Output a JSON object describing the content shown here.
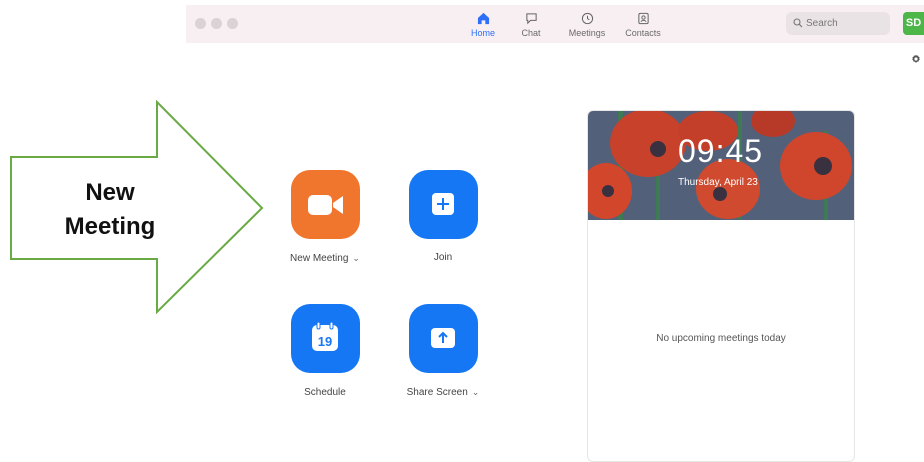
{
  "titlebar": {
    "tabs": [
      {
        "label": "Home",
        "icon": "home-icon",
        "active": true
      },
      {
        "label": "Chat",
        "icon": "chat-icon",
        "active": false
      },
      {
        "label": "Meetings",
        "icon": "clock-icon",
        "active": false
      },
      {
        "label": "Contacts",
        "icon": "contacts-icon",
        "active": false
      }
    ],
    "search": {
      "placeholder": "Search"
    },
    "avatar": {
      "initials": "SD",
      "color": "#4cb648"
    }
  },
  "callout": {
    "line1": "New",
    "line2": "Meeting"
  },
  "actions": {
    "new_meeting": {
      "label": "New Meeting",
      "color": "#f0762e",
      "icon": "video-camera-icon"
    },
    "join": {
      "label": "Join",
      "color": "#1677f5",
      "icon": "plus-icon"
    },
    "schedule": {
      "label": "Schedule",
      "color": "#1677f5",
      "icon": "calendar-icon",
      "day": "19"
    },
    "share_screen": {
      "label": "Share Screen",
      "color": "#1677f5",
      "icon": "upload-arrow-icon"
    }
  },
  "panel": {
    "time": "09:45",
    "date": "Thursday, April 23",
    "empty_text": "No upcoming meetings today"
  },
  "colors": {
    "accent": "#2d6ff6",
    "arrow_border": "#6aaa45"
  }
}
